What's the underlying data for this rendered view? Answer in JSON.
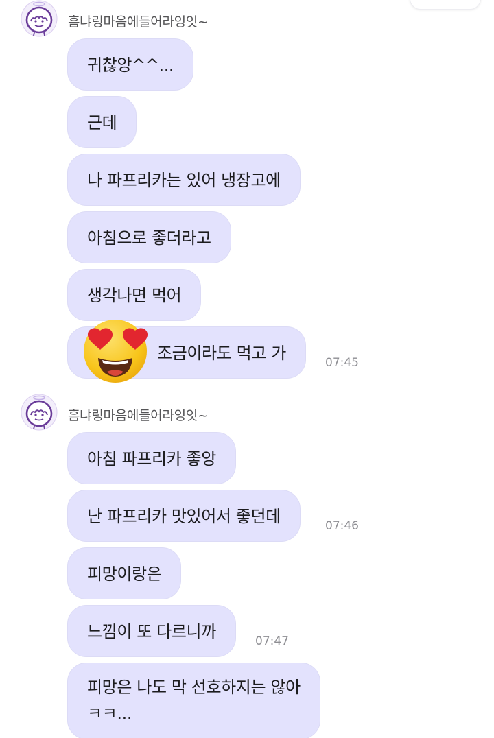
{
  "sender": {
    "name": "흠냐링마음에들어라잉잇~"
  },
  "groups": [
    {
      "messages": [
        {
          "text": "귀찮앙^^..."
        },
        {
          "text": "근데"
        },
        {
          "text": "나 파프리카는 있어 냉장고에"
        },
        {
          "text": "아침으로 좋더라고"
        },
        {
          "text": "생각나면 먹어"
        },
        {
          "text": "조금이라도 먹고 가",
          "time": "07:45"
        }
      ]
    },
    {
      "messages": [
        {
          "text": "아침 파프리카 좋앙"
        },
        {
          "text": "난 파프리카 맛있어서 좋던데",
          "time": "07:46"
        },
        {
          "text": "피망이랑은"
        },
        {
          "text": "느낌이 또 다르니까",
          "time": "07:47"
        },
        {
          "lines": [
            "피망은 나도 막 선호하지는 않아",
            "ㅋㅋ..."
          ]
        }
      ]
    }
  ],
  "sticker": {
    "icon": "heart-eyes-emoji-icon"
  },
  "colors": {
    "bubble": "#e3e2fd",
    "avatar_ring": "#c6b4e8",
    "avatar_line": "#6a3c99"
  }
}
